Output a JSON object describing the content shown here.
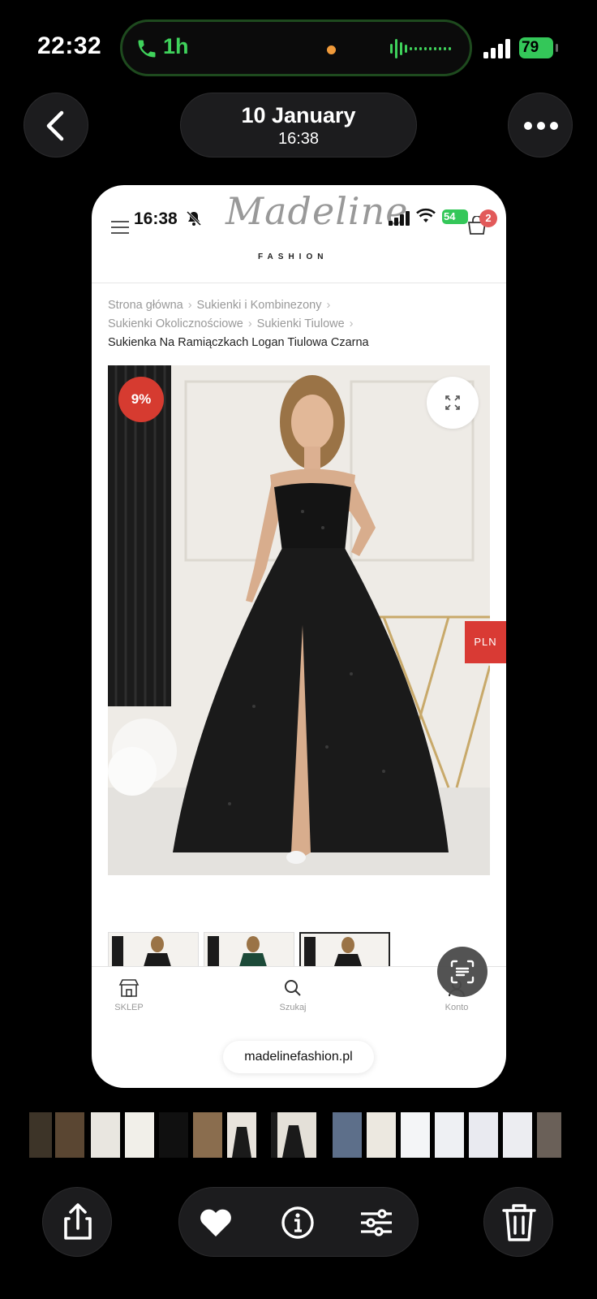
{
  "status_bar": {
    "time": "22:32",
    "call_duration": "1h",
    "battery": "79"
  },
  "header": {
    "date": "10 January",
    "time": "16:38"
  },
  "screenshot": {
    "status_time": "16:38",
    "battery": "54",
    "logo": "Madeline",
    "logo_sub": "FASHION",
    "cart_count": "2",
    "breadcrumb": [
      "Strona główna",
      "Sukienki i Kombinezony",
      "Sukienki Okolicznościowe",
      "Sukienki Tiulowe",
      "Sukienka Na Ramiączkach Logan Tiulowa Czarna"
    ],
    "discount_badge": "9%",
    "currency_tab": "PLN",
    "tabs": [
      {
        "label": "SKLEP",
        "icon": "shop-icon"
      },
      {
        "label": "Szukaj",
        "icon": "search-icon"
      },
      {
        "label": "Konto",
        "icon": "account-icon"
      }
    ],
    "url": "madelinefashion.pl"
  },
  "colors": {
    "accent_red": "#d63b30",
    "call_green": "#3fd25b",
    "battery_green": "#34c759"
  }
}
